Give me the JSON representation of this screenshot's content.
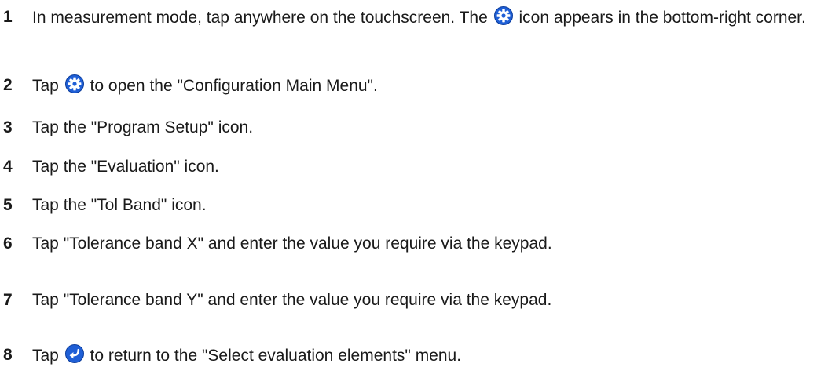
{
  "steps": [
    {
      "number": "1",
      "before_icon": "In measurement mode, tap anywhere on the touchscreen. The",
      "icon": "gear-icon",
      "after_icon": "icon appears in the bottom-right corner."
    },
    {
      "number": "2",
      "before_icon": "Tap",
      "icon": "gear-icon",
      "after_icon": "to open the \"Configuration Main Menu\"."
    },
    {
      "number": "3",
      "text": "Tap the \"Program Setup\" icon."
    },
    {
      "number": "4",
      "text": "Tap the \"Evaluation\" icon."
    },
    {
      "number": "5",
      "text": "Tap the \"Tol Band\" icon."
    },
    {
      "number": "6",
      "text": "Tap \"Tolerance band X\" and enter the value you require via the keypad."
    },
    {
      "number": "7",
      "text": "Tap \"Tolerance band Y\" and enter the value you require via the keypad."
    },
    {
      "number": "8",
      "before_icon": "Tap",
      "icon": "back-icon",
      "after_icon": "to return to the \"Select evaluation elements\" menu."
    }
  ],
  "icon_color": "#1f5fd6"
}
